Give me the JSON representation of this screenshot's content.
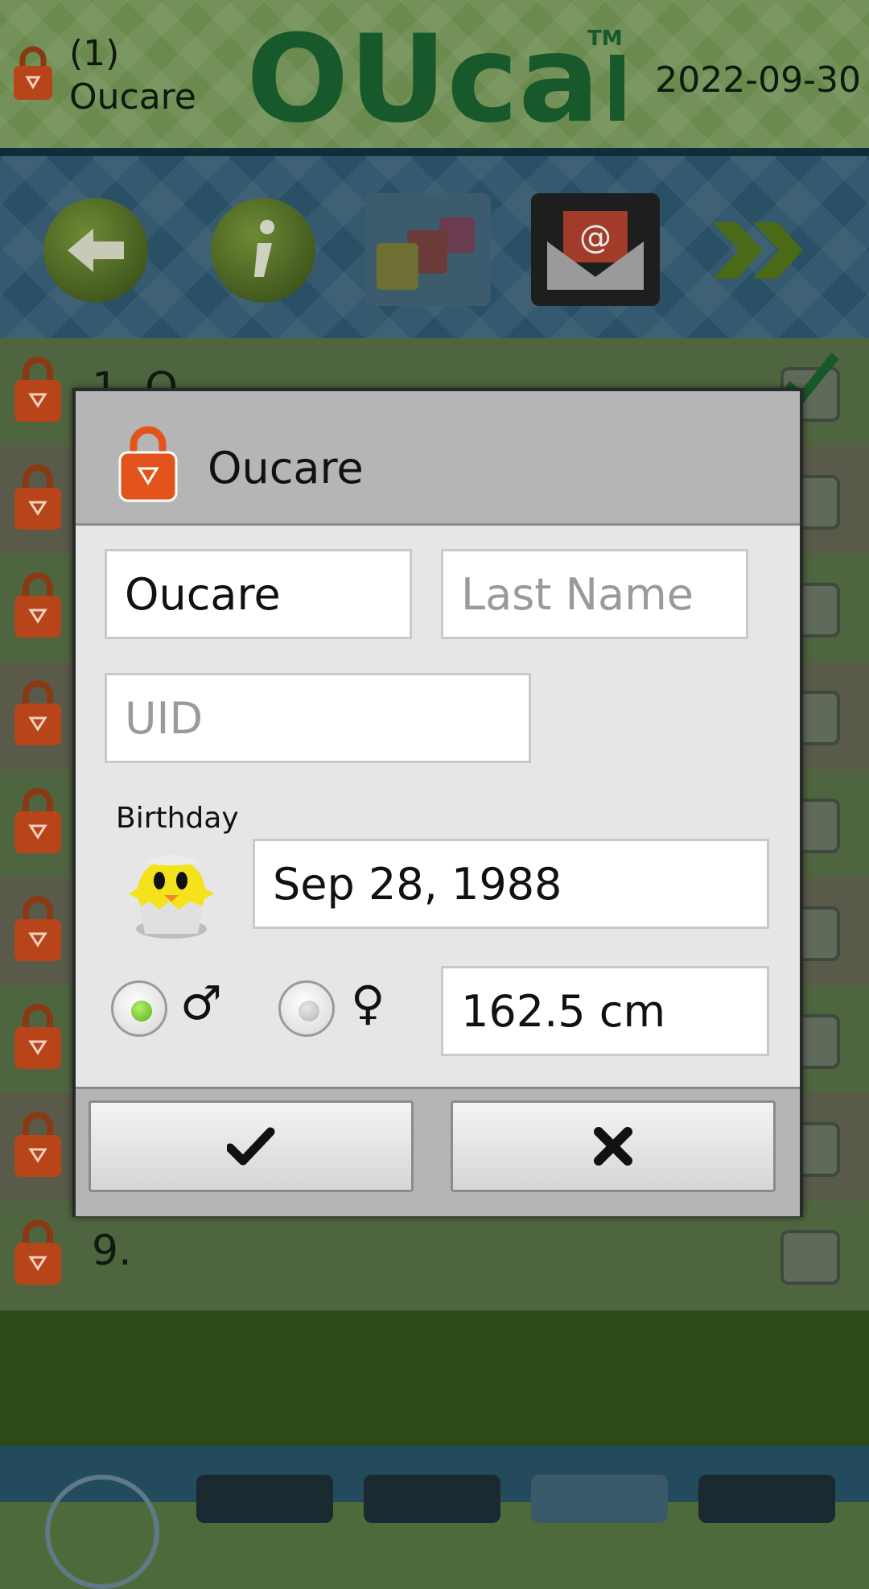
{
  "header": {
    "user_line1": "(1)",
    "user_line2": "Oucare",
    "logo_text": "OUcare",
    "logo_mark": "TM",
    "date": "2022-09-30"
  },
  "toolbar": {
    "buttons": [
      "back-arrow-icon",
      "info-icon",
      "users-icon",
      "email-icon",
      "forward-icon"
    ]
  },
  "list": {
    "rows": [
      {
        "label": "1. O",
        "checked": true
      },
      {
        "label": "",
        "checked": false
      },
      {
        "label": "",
        "checked": false
      },
      {
        "label": "",
        "checked": false
      },
      {
        "label": "",
        "checked": false
      },
      {
        "label": "",
        "checked": false
      },
      {
        "label": "",
        "checked": false
      },
      {
        "label": "",
        "checked": false
      },
      {
        "label": "9.",
        "checked": false
      }
    ]
  },
  "dialog": {
    "title": "Oucare",
    "first_name_value": "Oucare",
    "last_name_placeholder": "Last Name",
    "uid_placeholder": "UID",
    "birthday_label": "Birthday",
    "birthday_value": "Sep 28, 1988",
    "gender_selected": "male",
    "male_symbol": "♂",
    "female_symbol": "♀",
    "height_value": "162.5 cm",
    "ok_icon": "checkmark-icon",
    "cancel_icon": "cross-icon"
  },
  "colors": {
    "accent_green": "#1a5e2a",
    "lock_orange": "#e2541c",
    "radio_selected": "#7fd12f",
    "radio_unselected": "#c8c8c8"
  }
}
